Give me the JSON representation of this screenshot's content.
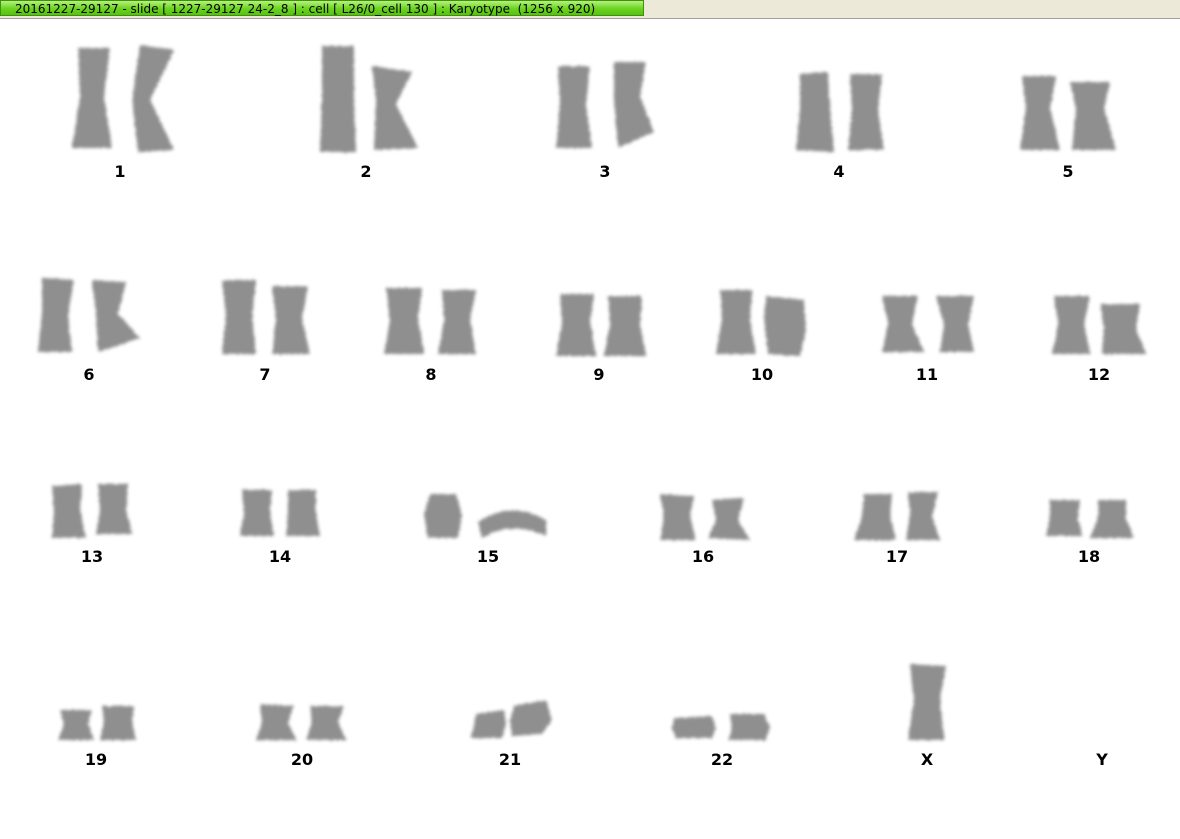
{
  "window": {
    "title": "20161227-29127 - slide [ 1227-29127 24-2_8 ] : cell [ L26/0_cell 130 ] : Karyotype  (1256 x 920)"
  },
  "karyotype": {
    "chromosome_fill": "#7c7c7c",
    "row1": [
      "1",
      "2",
      "3",
      "4",
      "5"
    ],
    "row2": [
      "6",
      "7",
      "8",
      "9",
      "10",
      "11",
      "12"
    ],
    "row3": [
      "13",
      "14",
      "15",
      "16",
      "17",
      "18"
    ],
    "row4": [
      "19",
      "20",
      "21",
      "22",
      "X",
      "Y"
    ]
  }
}
